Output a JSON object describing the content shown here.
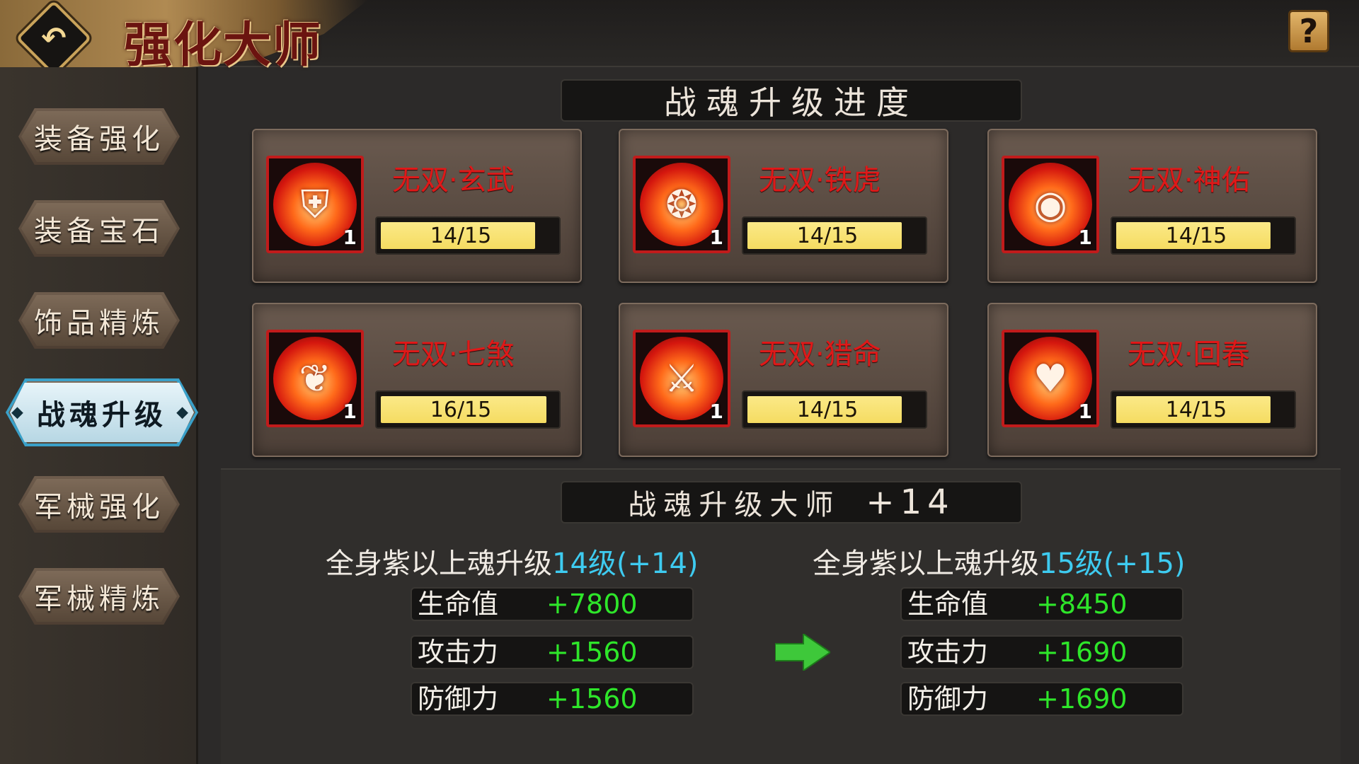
{
  "header": {
    "title": "强化大师",
    "back_icon": "back-arrow-icon",
    "help_label": "?"
  },
  "sidebar": {
    "items": [
      {
        "label": "装备强化",
        "active": false
      },
      {
        "label": "装备宝石",
        "active": false
      },
      {
        "label": "饰品精炼",
        "active": false
      },
      {
        "label": "战魂升级",
        "active": true
      },
      {
        "label": "军械强化",
        "active": false
      },
      {
        "label": "军械精炼",
        "active": false
      }
    ]
  },
  "progress": {
    "title": "战魂升级进度",
    "cards": [
      {
        "name": "无双·玄武",
        "level": "1",
        "progress_text": "14/15",
        "progress": 0.933,
        "icon": "shield-soul-icon"
      },
      {
        "name": "无双·铁虎",
        "level": "1",
        "progress_text": "14/15",
        "progress": 0.933,
        "icon": "tiger-soul-icon"
      },
      {
        "name": "无双·神佑",
        "level": "1",
        "progress_text": "14/15",
        "progress": 0.933,
        "icon": "ward-soul-icon"
      },
      {
        "name": "无双·七煞",
        "level": "1",
        "progress_text": "16/15",
        "progress": 1.0,
        "icon": "phoenix-soul-icon"
      },
      {
        "name": "无双·猎命",
        "level": "1",
        "progress_text": "14/15",
        "progress": 0.933,
        "icon": "blade-soul-icon"
      },
      {
        "name": "无双·回春",
        "level": "1",
        "progress_text": "14/15",
        "progress": 0.933,
        "icon": "heart-soul-icon"
      }
    ]
  },
  "master": {
    "title": "战魂升级大师",
    "bonus": "+14",
    "current": {
      "prefix": "全身紫以上魂升级",
      "level": "14级(+14)",
      "stats": [
        {
          "name": "生命值",
          "value": "+7800"
        },
        {
          "name": "攻击力",
          "value": "+1560"
        },
        {
          "name": "防御力",
          "value": "+1560"
        }
      ]
    },
    "next": {
      "prefix": "全身紫以上魂升级",
      "level": "15级(+15)",
      "stats": [
        {
          "name": "生命值",
          "value": "+8450"
        },
        {
          "name": "攻击力",
          "value": "+1690"
        },
        {
          "name": "防御力",
          "value": "+1690"
        }
      ]
    },
    "arrow_icon": "green-right-arrow-icon"
  },
  "colors": {
    "soul_name": "#e01818",
    "stat_value": "#2ee62a",
    "highlight": "#3ecbf0",
    "progress_fill": "#f5dc62",
    "active_tab": "#3aa0c8"
  }
}
